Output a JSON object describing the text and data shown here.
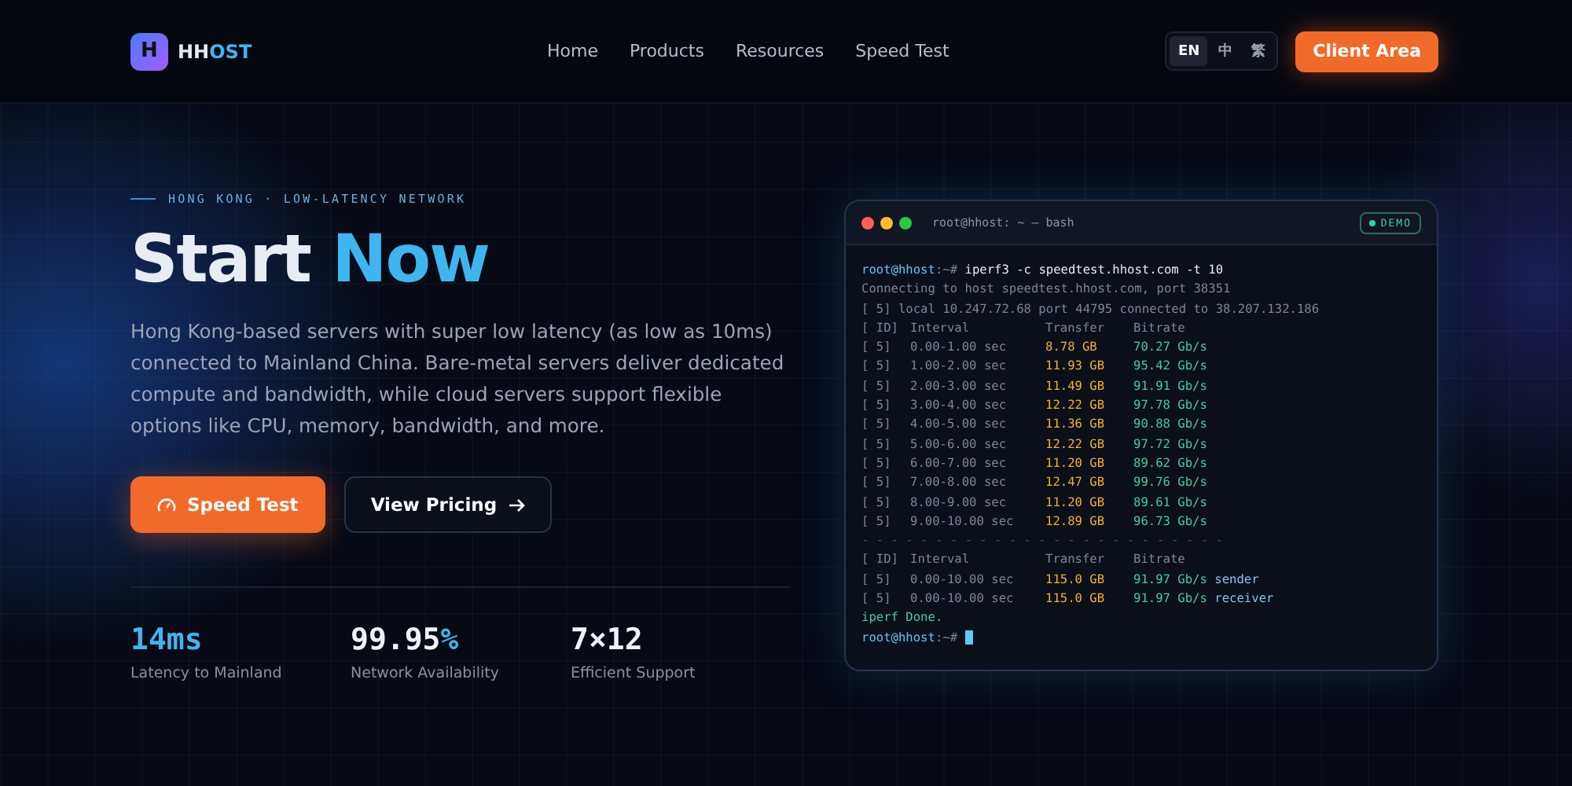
{
  "logo": {
    "mark": "H",
    "parts": [
      {
        "text": "HH",
        "accent": false
      },
      {
        "text": "OST",
        "accent": true
      }
    ]
  },
  "nav": [
    "Home",
    "Products",
    "Resources",
    "Speed Test"
  ],
  "languages": [
    {
      "label": "EN",
      "selected": true
    },
    {
      "label": "中",
      "selected": false
    },
    {
      "label": "繁",
      "selected": false
    }
  ],
  "client_button": "Client Area",
  "hero": {
    "eyebrow": "HONG KONG · LOW-LATENCY NETWORK",
    "title": [
      {
        "text": "Start ",
        "accent": false
      },
      {
        "text": "Now",
        "accent": true
      }
    ],
    "description": "Hong Kong-based servers with super low latency (as low as 10ms) connected to Mainland China. Bare-metal servers deliver dedicated compute and bandwidth, while cloud servers support flexible options like CPU, memory, bandwidth, and more.",
    "buttons": [
      {
        "kind": "primary",
        "label": "Speed Test"
      },
      {
        "kind": "secondary",
        "label": "View Pricing"
      }
    ]
  },
  "stats": [
    {
      "parts": [
        {
          "text": "14ms",
          "accent": true
        }
      ],
      "label": "Latency to Mainland"
    },
    {
      "parts": [
        {
          "text": "99.95",
          "accent": false
        },
        {
          "text": "%",
          "accent": true
        }
      ],
      "label": "Network Availability"
    },
    {
      "parts": [
        {
          "text": "7×12",
          "accent": false
        }
      ],
      "label": "Efficient Support"
    }
  ],
  "terminal": {
    "title": "root@hhost: ~ — bash",
    "badge": "DEMO",
    "lines": [
      {
        "kind": "command",
        "prompt": "root@hhost",
        "path": ":~#",
        "text": "iperf3 -c speedtest.hhost.com -t 10"
      },
      {
        "kind": "info",
        "text": "Connecting to host speedtest.hhost.com, port 38351"
      },
      {
        "kind": "info",
        "text": "[ 5] local 10.247.72.68 port 44795 connected to 38.207.132.186"
      },
      {
        "kind": "header",
        "id": "[ ID]",
        "interval": "Interval",
        "transfer": "Transfer",
        "bitrate": "Bitrate"
      },
      {
        "kind": "row",
        "id": "[ 5]",
        "interval": "0.00-1.00 sec",
        "transfer": "8.78 GB",
        "bitrate": "70.27 Gb/s"
      },
      {
        "kind": "row",
        "id": "[ 5]",
        "interval": "1.00-2.00 sec",
        "transfer": "11.93 GB",
        "bitrate": "95.42 Gb/s"
      },
      {
        "kind": "row",
        "id": "[ 5]",
        "interval": "2.00-3.00 sec",
        "transfer": "11.49 GB",
        "bitrate": "91.91 Gb/s"
      },
      {
        "kind": "row",
        "id": "[ 5]",
        "interval": "3.00-4.00 sec",
        "transfer": "12.22 GB",
        "bitrate": "97.78 Gb/s"
      },
      {
        "kind": "row",
        "id": "[ 5]",
        "interval": "4.00-5.00 sec",
        "transfer": "11.36 GB",
        "bitrate": "90.88 Gb/s"
      },
      {
        "kind": "row",
        "id": "[ 5]",
        "interval": "5.00-6.00 sec",
        "transfer": "12.22 GB",
        "bitrate": "97.72 Gb/s"
      },
      {
        "kind": "row",
        "id": "[ 5]",
        "interval": "6.00-7.00 sec",
        "transfer": "11.20 GB",
        "bitrate": "89.62 Gb/s"
      },
      {
        "kind": "row",
        "id": "[ 5]",
        "interval": "7.00-8.00 sec",
        "transfer": "12.47 GB",
        "bitrate": "99.76 Gb/s"
      },
      {
        "kind": "row",
        "id": "[ 5]",
        "interval": "8.00-9.00 sec",
        "transfer": "11.20 GB",
        "bitrate": "89.61 Gb/s"
      },
      {
        "kind": "row",
        "id": "[ 5]",
        "interval": "9.00-10.00 sec",
        "transfer": "12.89 GB",
        "bitrate": "96.73 Gb/s"
      },
      {
        "kind": "divider",
        "text": "- - - - - - - - - - - - - - - - - - - - - - - - -"
      },
      {
        "kind": "header",
        "id": "[ ID]",
        "interval": "Interval",
        "transfer": "Transfer",
        "bitrate": "Bitrate"
      },
      {
        "kind": "row",
        "id": "[ 5]",
        "interval": "0.00-10.00 sec",
        "transfer": "115.0 GB",
        "bitrate": "91.97 Gb/s",
        "note": "sender"
      },
      {
        "kind": "row",
        "id": "[ 5]",
        "interval": "0.00-10.00 sec",
        "transfer": "115.0 GB",
        "bitrate": "91.97 Gb/s",
        "note": "receiver"
      },
      {
        "kind": "done",
        "text": "iperf Done."
      },
      {
        "kind": "prompt",
        "prompt": "root@hhost",
        "path": ":~#"
      }
    ]
  }
}
